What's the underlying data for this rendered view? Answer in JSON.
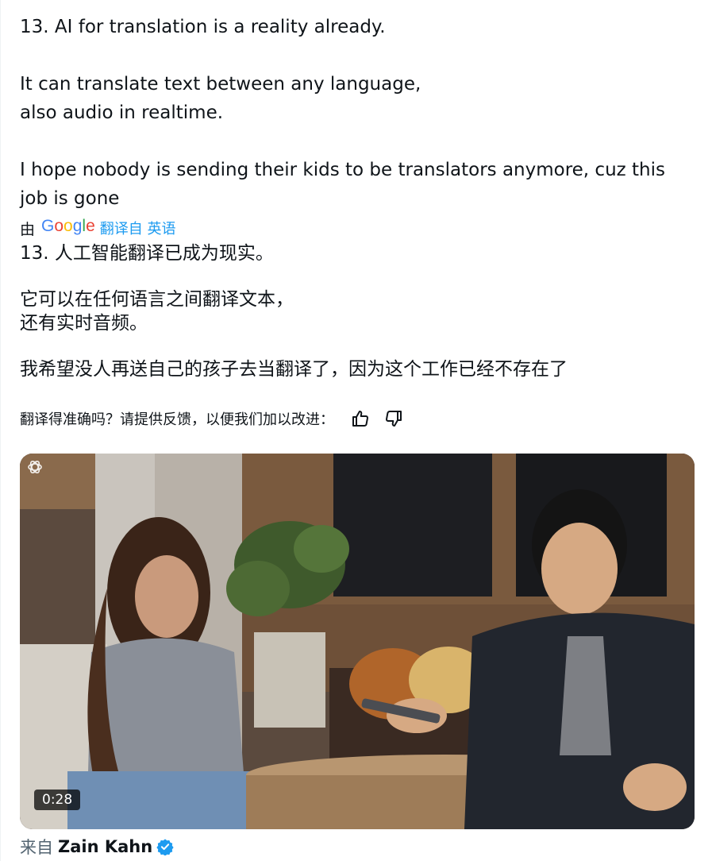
{
  "tweet": {
    "original": {
      "paragraphs": [
        "13.  AI for translation is a reality already.",
        "It can translate text between any language,\nalso audio in realtime.",
        "I hope nobody is sending their kids to be translators anymore, cuz this\njob is gone"
      ]
    },
    "translation_meta": {
      "by_prefix": "由",
      "provider": "Google",
      "from_lang": "翻译自 英语"
    },
    "translated": {
      "paragraphs": [
        "13. 人工智能翻译已成为现实。",
        "它可以在任何语言之间翻译文本，\n还有实时音频。",
        "我希望没人再送自己的孩子去当翻译了，因为这个工作已经不存在了"
      ]
    },
    "feedback": {
      "question": "翻译得准确吗？请提供反馈，以便我们加以改进：",
      "thumbs_up_icon": "thumbs-up-icon",
      "thumbs_down_icon": "thumbs-down-icon"
    },
    "video": {
      "duration": "0:28",
      "logo_icon": "openai-logo-icon"
    },
    "source": {
      "prefix": "来自",
      "author": "Zain Kahn",
      "verified_icon": "verified-badge-icon"
    }
  },
  "colors": {
    "text": "#0f1419",
    "muted": "#536471",
    "link": "#1d9bf0",
    "verified": "#1d9bf0"
  }
}
